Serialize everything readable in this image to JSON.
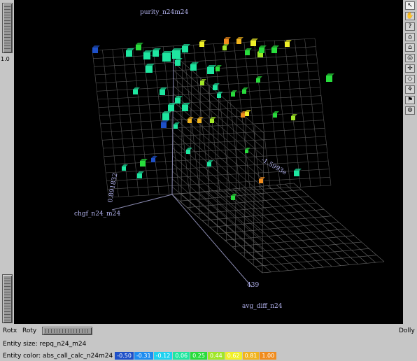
{
  "viewer": {
    "axis_labels": {
      "y": "purity_n24m24",
      "z": "chgf_n24_m24",
      "x": "avg_diff_n24"
    },
    "tick_labels": {
      "x_max": "439",
      "z_tick": "0.891832",
      "y_tick": "-1.5993e"
    }
  },
  "left_panel": {
    "zoom_value": "1.0"
  },
  "right_panel": {
    "tools": [
      {
        "icon": "arrow-icon",
        "glyph": "↖"
      },
      {
        "icon": "hand-icon",
        "glyph": "✋"
      },
      {
        "icon": "help-icon",
        "glyph": "?"
      },
      {
        "icon": "home-icon",
        "glyph": "⌂"
      },
      {
        "icon": "set-home-icon",
        "glyph": "⌂"
      },
      {
        "icon": "view-all-icon",
        "glyph": "◎"
      },
      {
        "icon": "seek-icon",
        "glyph": "✛"
      },
      {
        "icon": "perspective-icon",
        "glyph": "◇"
      },
      {
        "icon": "stereo-icon",
        "glyph": "⚘"
      },
      {
        "icon": "pick-icon",
        "glyph": "⚑"
      },
      {
        "icon": "tool-icon",
        "glyph": "⚙"
      }
    ]
  },
  "bottom_bar": {
    "rotx": "Rotx",
    "roty": "Roty",
    "dolly": "Dolly"
  },
  "status": {
    "entity_size": "Entity size: repq_n24_m24",
    "entity_color_label": "Entity color: abs_call_calc_n24m24",
    "legend": [
      {
        "label": "-0.50",
        "color": "#1e50c8"
      },
      {
        "label": "-0.31",
        "color": "#1e8cf0"
      },
      {
        "label": "-0.12",
        "color": "#1ed2f0"
      },
      {
        "label": "0.06",
        "color": "#1ee6a0"
      },
      {
        "label": "0.25",
        "color": "#28dc3c"
      },
      {
        "label": "0.44",
        "color": "#a0e628"
      },
      {
        "label": "0.62",
        "color": "#f0f028"
      },
      {
        "label": "0.81",
        "color": "#f0b41e"
      },
      {
        "label": "1.00",
        "color": "#f08c1e"
      }
    ]
  }
}
